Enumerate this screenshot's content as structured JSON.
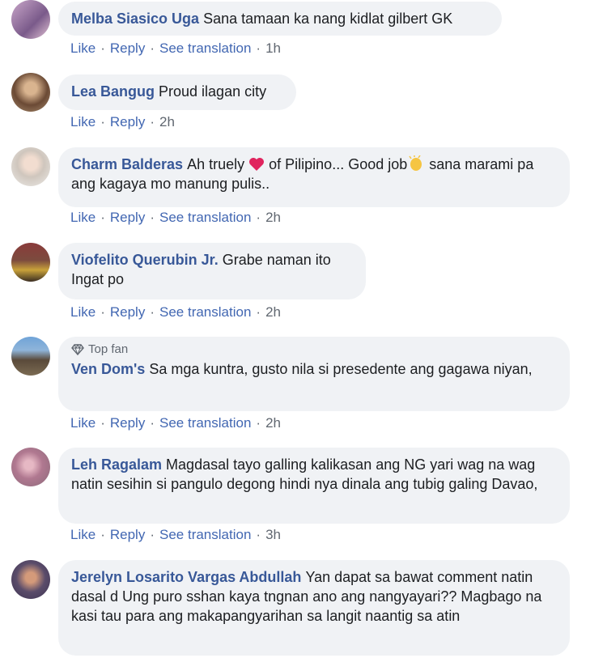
{
  "comments": [
    {
      "name": "Melba Siasico Uga",
      "text": "Sana tamaan ka nang kidlat gilbert GK",
      "like": "Like",
      "reply": "Reply",
      "translate": "See translation",
      "time": "1h"
    },
    {
      "name": "Lea Bangug",
      "text": "Proud ilagan city",
      "like": "Like",
      "reply": "Reply",
      "time": "2h"
    },
    {
      "name": "Charm Balderas",
      "text_before": "Ah truely",
      "text_middle": "of Pilipino... Good job",
      "text_after": "sana marami pa ang kagaya mo manung pulis..",
      "like": "Like",
      "reply": "Reply",
      "translate": "See translation",
      "time": "2h"
    },
    {
      "name": "Viofelito Querubin Jr.",
      "text": "Grabe naman ito",
      "text2": "Ingat po",
      "like": "Like",
      "reply": "Reply",
      "translate": "See translation",
      "time": "2h"
    },
    {
      "badge": "Top fan",
      "name": "Ven Dom's",
      "text": "Sa mga kuntra, gusto nila si presedente ang gagawa niyan,",
      "like": "Like",
      "reply": "Reply",
      "translate": "See translation",
      "time": "2h"
    },
    {
      "name": "Leh Ragalam",
      "text": "Magdasal tayo galling kalikasan ang NG yari wag na wag natin sesihin si pangulo degong hindi nya dinala ang tubig galing Davao,",
      "like": "Like",
      "reply": "Reply",
      "translate": "See translation",
      "time": "3h"
    },
    {
      "name": "Jerelyn Losarito Vargas Abdullah",
      "text": "Yan dapat sa bawat comment natin dasal d Ung puro sshan kaya tngnan ano ang nangyayari?? Magbago na kasi tau para ang makapangyarihan sa langit naantig sa atin"
    }
  ],
  "icons": {
    "badge": "diamond-icon",
    "heart": "red-heart-emoji",
    "clap": "clapping-hands-emoji"
  },
  "colors": {
    "name": "#385898",
    "bubble": "#f0f2f5",
    "meta": "#606770"
  }
}
